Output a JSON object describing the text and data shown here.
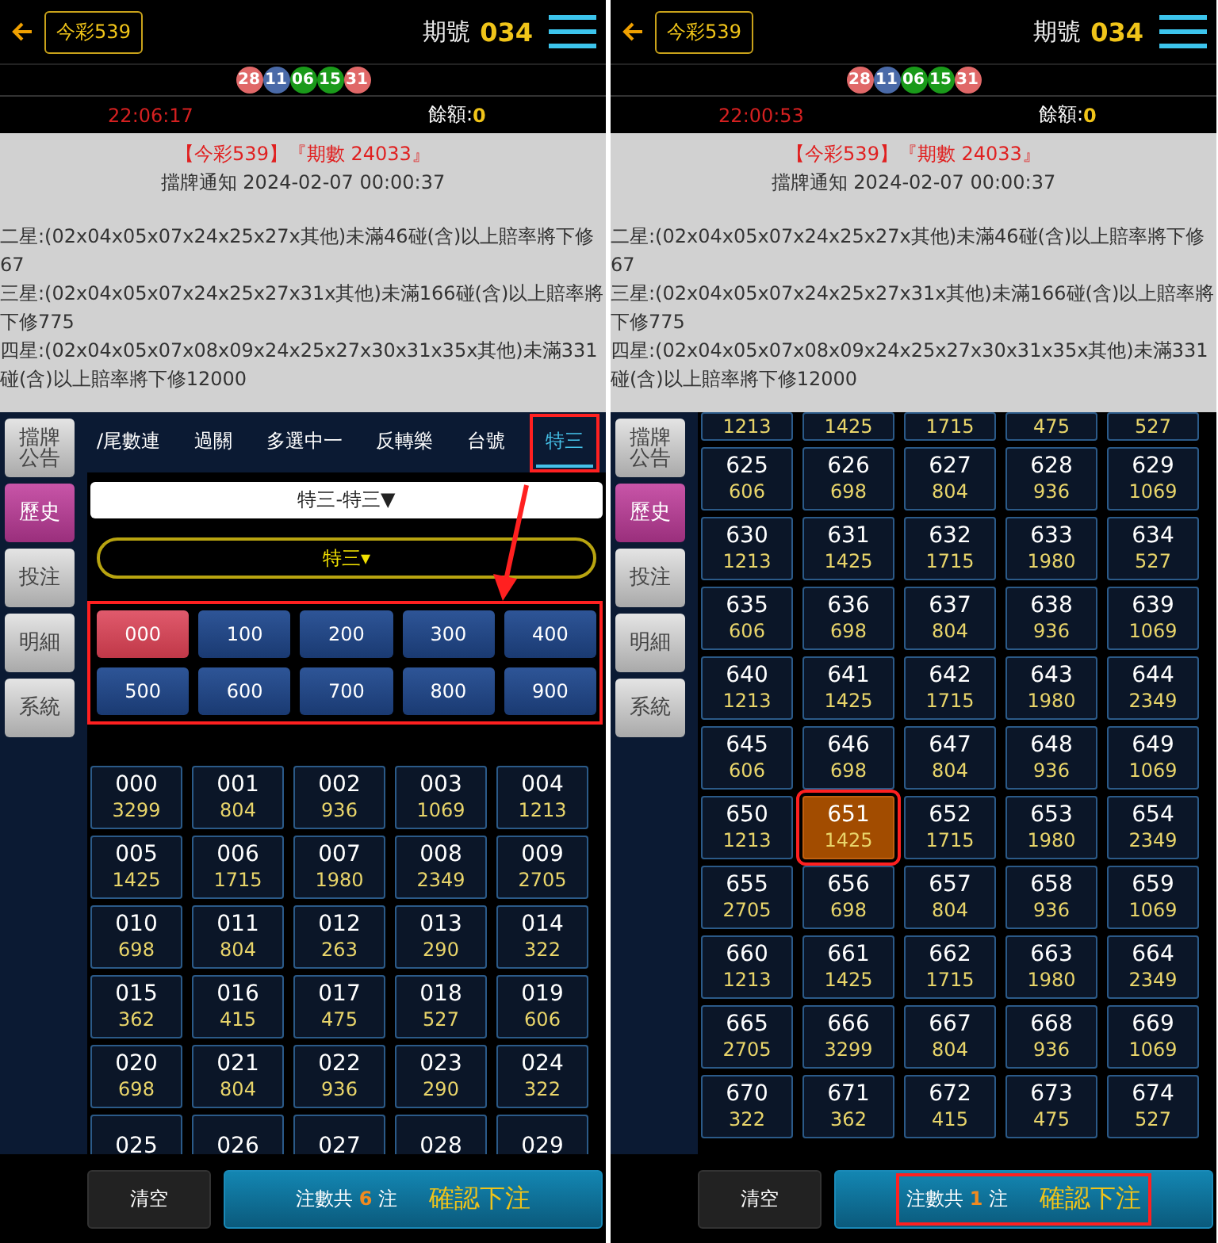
{
  "panels": [
    {
      "header": {
        "title": "今彩539",
        "period_label": "期號",
        "period": "034"
      },
      "balls": [
        {
          "number": "28",
          "color": "#e06868"
        },
        {
          "number": "11",
          "color": "#4a6aa8"
        },
        {
          "number": "06",
          "color": "#1a9a1a"
        },
        {
          "number": "15",
          "color": "#1a9a1a"
        },
        {
          "number": "31",
          "color": "#e06868"
        }
      ],
      "clock": "22:06:17",
      "balance_label": "餘額:",
      "balance": "0",
      "notice": {
        "headline": "【今彩539】『期數 24033』",
        "subtitle": "擋牌通知 2024-02-07 00:00:37",
        "lines": [
          "二星:(02x04x05x07x24x25x27x其他)未滿46碰(含)以上賠率將下修67",
          "三星:(02x04x05x07x24x25x27x31x其他)未滿166碰(含)以上賠率將下修775",
          "四星:(02x04x05x07x08x09x24x25x27x30x31x35x其他)未滿331碰(含)以上賠率將下修12000"
        ]
      },
      "sidebar": [
        {
          "label": "擋牌公告",
          "selected": false
        },
        {
          "label": "歷史",
          "selected": true
        },
        {
          "label": "投注",
          "selected": false
        },
        {
          "label": "明細",
          "selected": false
        },
        {
          "label": "系統",
          "selected": false
        }
      ],
      "tabs": [
        {
          "label": "/尾數連",
          "selected": false,
          "annotated": false
        },
        {
          "label": "過關",
          "selected": false,
          "annotated": false
        },
        {
          "label": "多選中一",
          "selected": false,
          "annotated": false
        },
        {
          "label": "反轉樂",
          "selected": false,
          "annotated": false
        },
        {
          "label": "台號",
          "selected": false,
          "annotated": false
        },
        {
          "label": "特三",
          "selected": true,
          "annotated": true
        }
      ],
      "dropdown": "特三-特三▼",
      "pill": "特三▾",
      "arrow": true,
      "groups": {
        "annotated": true,
        "items": [
          {
            "label": "000",
            "selected": true
          },
          {
            "label": "100",
            "selected": false
          },
          {
            "label": "200",
            "selected": false
          },
          {
            "label": "300",
            "selected": false
          },
          {
            "label": "400",
            "selected": false
          },
          {
            "label": "500",
            "selected": false
          },
          {
            "label": "600",
            "selected": false
          },
          {
            "label": "700",
            "selected": false
          },
          {
            "label": "800",
            "selected": false
          },
          {
            "label": "900",
            "selected": false
          }
        ]
      },
      "grid": [
        {
          "kind": "full",
          "number": "000",
          "odds": "3299",
          "selected": false,
          "annotated": false
        },
        {
          "kind": "full",
          "number": "001",
          "odds": "804",
          "selected": false,
          "annotated": false
        },
        {
          "kind": "full",
          "number": "002",
          "odds": "936",
          "selected": false,
          "annotated": false
        },
        {
          "kind": "full",
          "number": "003",
          "odds": "1069",
          "selected": false,
          "annotated": false
        },
        {
          "kind": "full",
          "number": "004",
          "odds": "1213",
          "selected": false,
          "annotated": false
        },
        {
          "kind": "full",
          "number": "005",
          "odds": "1425",
          "selected": false,
          "annotated": false
        },
        {
          "kind": "full",
          "number": "006",
          "odds": "1715",
          "selected": false,
          "annotated": false
        },
        {
          "kind": "full",
          "number": "007",
          "odds": "1980",
          "selected": false,
          "annotated": false
        },
        {
          "kind": "full",
          "number": "008",
          "odds": "2349",
          "selected": false,
          "annotated": false
        },
        {
          "kind": "full",
          "number": "009",
          "odds": "2705",
          "selected": false,
          "annotated": false
        },
        {
          "kind": "full",
          "number": "010",
          "odds": "698",
          "selected": false,
          "annotated": false
        },
        {
          "kind": "full",
          "number": "011",
          "odds": "804",
          "selected": false,
          "annotated": false
        },
        {
          "kind": "full",
          "number": "012",
          "odds": "263",
          "selected": false,
          "annotated": false
        },
        {
          "kind": "full",
          "number": "013",
          "odds": "290",
          "selected": false,
          "annotated": false
        },
        {
          "kind": "full",
          "number": "014",
          "odds": "322",
          "selected": false,
          "annotated": false
        },
        {
          "kind": "full",
          "number": "015",
          "odds": "362",
          "selected": false,
          "annotated": false
        },
        {
          "kind": "full",
          "number": "016",
          "odds": "415",
          "selected": false,
          "annotated": false
        },
        {
          "kind": "full",
          "number": "017",
          "odds": "475",
          "selected": false,
          "annotated": false
        },
        {
          "kind": "full",
          "number": "018",
          "odds": "527",
          "selected": false,
          "annotated": false
        },
        {
          "kind": "full",
          "number": "019",
          "odds": "606",
          "selected": false,
          "annotated": false
        },
        {
          "kind": "full",
          "number": "020",
          "odds": "698",
          "selected": false,
          "annotated": false
        },
        {
          "kind": "full",
          "number": "021",
          "odds": "804",
          "selected": false,
          "annotated": false
        },
        {
          "kind": "full",
          "number": "022",
          "odds": "936",
          "selected": false,
          "annotated": false
        },
        {
          "kind": "full",
          "number": "023",
          "odds": "290",
          "selected": false,
          "annotated": false
        },
        {
          "kind": "full",
          "number": "024",
          "odds": "322",
          "selected": false,
          "annotated": false
        },
        {
          "kind": "full",
          "number": "025",
          "selected": false,
          "annotated": false
        },
        {
          "kind": "full",
          "number": "026",
          "selected": false,
          "annotated": false
        },
        {
          "kind": "full",
          "number": "027",
          "selected": false,
          "annotated": false
        },
        {
          "kind": "full",
          "number": "028",
          "selected": false,
          "annotated": false
        },
        {
          "kind": "full",
          "number": "029",
          "selected": false,
          "annotated": false
        }
      ],
      "footer": {
        "clear": "清空",
        "count_prefix": "注數共",
        "count": "6",
        "count_suffix": "注",
        "confirm": "確認下注",
        "annotated": false
      }
    },
    {
      "header": {
        "title": "今彩539",
        "period_label": "期號",
        "period": "034"
      },
      "balls": [
        {
          "number": "28",
          "color": "#e06868"
        },
        {
          "number": "11",
          "color": "#4a6aa8"
        },
        {
          "number": "06",
          "color": "#1a9a1a"
        },
        {
          "number": "15",
          "color": "#1a9a1a"
        },
        {
          "number": "31",
          "color": "#e06868"
        }
      ],
      "clock": "22:00:53",
      "balance_label": "餘額:",
      "balance": "0",
      "notice": {
        "headline": "【今彩539】『期數 24033』",
        "subtitle": "擋牌通知 2024-02-07 00:00:37",
        "lines": [
          "二星:(02x04x05x07x24x25x27x其他)未滿46碰(含)以上賠率將下修67",
          "三星:(02x04x05x07x24x25x27x31x其他)未滿166碰(含)以上賠率將下修775",
          "四星:(02x04x05x07x08x09x24x25x27x30x31x35x其他)未滿331碰(含)以上賠率將下修12000"
        ]
      },
      "sidebar": [
        {
          "label": "擋牌公告",
          "selected": false
        },
        {
          "label": "歷史",
          "selected": true
        },
        {
          "label": "投注",
          "selected": false
        },
        {
          "label": "明細",
          "selected": false
        },
        {
          "label": "系統",
          "selected": false
        }
      ],
      "grid": [
        {
          "kind": "cut_top",
          "odds": "1213",
          "selected": false,
          "annotated": false
        },
        {
          "kind": "cut_top",
          "odds": "1425",
          "selected": false,
          "annotated": false
        },
        {
          "kind": "cut_top",
          "odds": "1715",
          "selected": false,
          "annotated": false
        },
        {
          "kind": "cut_top",
          "odds": "475",
          "selected": false,
          "annotated": false
        },
        {
          "kind": "cut_top",
          "odds": "527",
          "selected": false,
          "annotated": false
        },
        {
          "kind": "full",
          "number": "625",
          "odds": "606",
          "selected": false,
          "annotated": false
        },
        {
          "kind": "full",
          "number": "626",
          "odds": "698",
          "selected": false,
          "annotated": false
        },
        {
          "kind": "full",
          "number": "627",
          "odds": "804",
          "selected": false,
          "annotated": false
        },
        {
          "kind": "full",
          "number": "628",
          "odds": "936",
          "selected": false,
          "annotated": false
        },
        {
          "kind": "full",
          "number": "629",
          "odds": "1069",
          "selected": false,
          "annotated": false
        },
        {
          "kind": "full",
          "number": "630",
          "odds": "1213",
          "selected": false,
          "annotated": false
        },
        {
          "kind": "full",
          "number": "631",
          "odds": "1425",
          "selected": false,
          "annotated": false
        },
        {
          "kind": "full",
          "number": "632",
          "odds": "1715",
          "selected": false,
          "annotated": false
        },
        {
          "kind": "full",
          "number": "633",
          "odds": "1980",
          "selected": false,
          "annotated": false
        },
        {
          "kind": "full",
          "number": "634",
          "odds": "527",
          "selected": false,
          "annotated": false
        },
        {
          "kind": "full",
          "number": "635",
          "odds": "606",
          "selected": false,
          "annotated": false
        },
        {
          "kind": "full",
          "number": "636",
          "odds": "698",
          "selected": false,
          "annotated": false
        },
        {
          "kind": "full",
          "number": "637",
          "odds": "804",
          "selected": false,
          "annotated": false
        },
        {
          "kind": "full",
          "number": "638",
          "odds": "936",
          "selected": false,
          "annotated": false
        },
        {
          "kind": "full",
          "number": "639",
          "odds": "1069",
          "selected": false,
          "annotated": false
        },
        {
          "kind": "full",
          "number": "640",
          "odds": "1213",
          "selected": false,
          "annotated": false
        },
        {
          "kind": "full",
          "number": "641",
          "odds": "1425",
          "selected": false,
          "annotated": false
        },
        {
          "kind": "full",
          "number": "642",
          "odds": "1715",
          "selected": false,
          "annotated": false
        },
        {
          "kind": "full",
          "number": "643",
          "odds": "1980",
          "selected": false,
          "annotated": false
        },
        {
          "kind": "full",
          "number": "644",
          "odds": "2349",
          "selected": false,
          "annotated": false
        },
        {
          "kind": "full",
          "number": "645",
          "odds": "606",
          "selected": false,
          "annotated": false
        },
        {
          "kind": "full",
          "number": "646",
          "odds": "698",
          "selected": false,
          "annotated": false
        },
        {
          "kind": "full",
          "number": "647",
          "odds": "804",
          "selected": false,
          "annotated": false
        },
        {
          "kind": "full",
          "number": "648",
          "odds": "936",
          "selected": false,
          "annotated": false
        },
        {
          "kind": "full",
          "number": "649",
          "odds": "1069",
          "selected": false,
          "annotated": false
        },
        {
          "kind": "full",
          "number": "650",
          "odds": "1213",
          "selected": false,
          "annotated": false
        },
        {
          "kind": "full",
          "number": "651",
          "odds": "1425",
          "selected": true,
          "annotated": true
        },
        {
          "kind": "full",
          "number": "652",
          "odds": "1715",
          "selected": false,
          "annotated": false
        },
        {
          "kind": "full",
          "number": "653",
          "odds": "1980",
          "selected": false,
          "annotated": false
        },
        {
          "kind": "full",
          "number": "654",
          "odds": "2349",
          "selected": false,
          "annotated": false
        },
        {
          "kind": "full",
          "number": "655",
          "odds": "2705",
          "selected": false,
          "annotated": false
        },
        {
          "kind": "full",
          "number": "656",
          "odds": "698",
          "selected": false,
          "annotated": false
        },
        {
          "kind": "full",
          "number": "657",
          "odds": "804",
          "selected": false,
          "annotated": false
        },
        {
          "kind": "full",
          "number": "658",
          "odds": "936",
          "selected": false,
          "annotated": false
        },
        {
          "kind": "full",
          "number": "659",
          "odds": "1069",
          "selected": false,
          "annotated": false
        },
        {
          "kind": "full",
          "number": "660",
          "odds": "1213",
          "selected": false,
          "annotated": false
        },
        {
          "kind": "full",
          "number": "661",
          "odds": "1425",
          "selected": false,
          "annotated": false
        },
        {
          "kind": "full",
          "number": "662",
          "odds": "1715",
          "selected": false,
          "annotated": false
        },
        {
          "kind": "full",
          "number": "663",
          "odds": "1980",
          "selected": false,
          "annotated": false
        },
        {
          "kind": "full",
          "number": "664",
          "odds": "2349",
          "selected": false,
          "annotated": false
        },
        {
          "kind": "full",
          "number": "665",
          "odds": "2705",
          "selected": false,
          "annotated": false
        },
        {
          "kind": "full",
          "number": "666",
          "odds": "3299",
          "selected": false,
          "annotated": false
        },
        {
          "kind": "full",
          "number": "667",
          "odds": "804",
          "selected": false,
          "annotated": false
        },
        {
          "kind": "full",
          "number": "668",
          "odds": "936",
          "selected": false,
          "annotated": false
        },
        {
          "kind": "full",
          "number": "669",
          "odds": "1069",
          "selected": false,
          "annotated": false
        },
        {
          "kind": "full",
          "number": "670",
          "odds": "322",
          "selected": false,
          "annotated": false
        },
        {
          "kind": "full",
          "number": "671",
          "odds": "362",
          "selected": false,
          "annotated": false
        },
        {
          "kind": "full",
          "number": "672",
          "odds": "415",
          "selected": false,
          "annotated": false
        },
        {
          "kind": "full",
          "number": "673",
          "odds": "475",
          "selected": false,
          "annotated": false
        },
        {
          "kind": "full",
          "number": "674",
          "odds": "527",
          "selected": false,
          "annotated": false
        }
      ],
      "footer": {
        "clear": "清空",
        "count_prefix": "注數共",
        "count": "1",
        "count_suffix": "注",
        "confirm": "確認下注",
        "annotated": true
      }
    }
  ]
}
